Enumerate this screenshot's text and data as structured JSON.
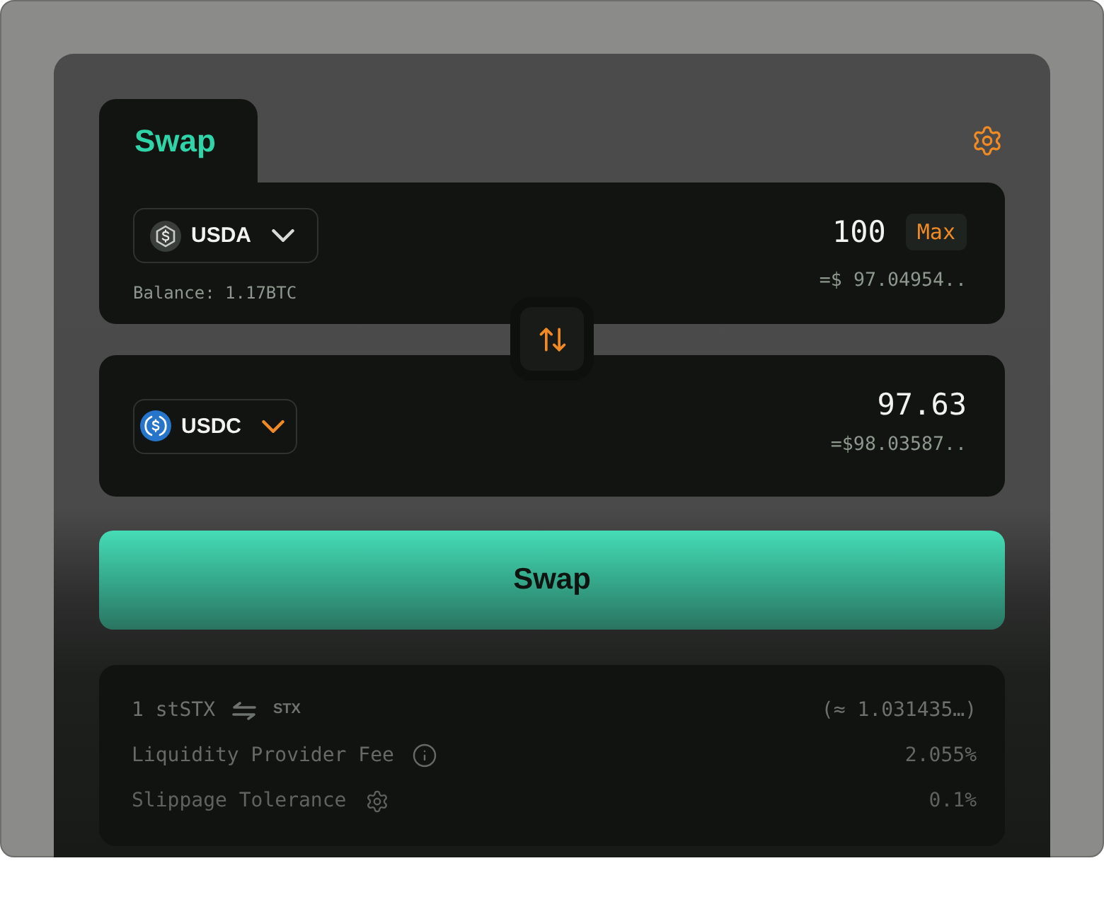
{
  "tabs": [
    {
      "label": "Swap",
      "selected": true
    }
  ],
  "panels": [
    {
      "token": {
        "symbol": "USDA",
        "color": "#3a3e3a",
        "highlighted": false
      },
      "amount": "100",
      "max_label": "Max",
      "usd_value": "=$ 97.04954..",
      "balance": "Balance: 1.17BTC"
    },
    {
      "token": {
        "symbol": "USDC",
        "color": "#2775ca",
        "highlighted": true
      },
      "amount": "97.63",
      "usd_value": "=$98.03587.."
    }
  ],
  "swap_button": {
    "label": "Swap"
  },
  "details": [
    {
      "kind": "rate",
      "base": "1 stSTX",
      "quote": "STX",
      "value": "(≈ 1.031435…)"
    },
    {
      "kind": "info",
      "label": "Liquidity Provider Fee",
      "value": "2.055%"
    },
    {
      "kind": "setting",
      "label": "Slippage Tolerance",
      "value": "0.1%"
    }
  ]
}
